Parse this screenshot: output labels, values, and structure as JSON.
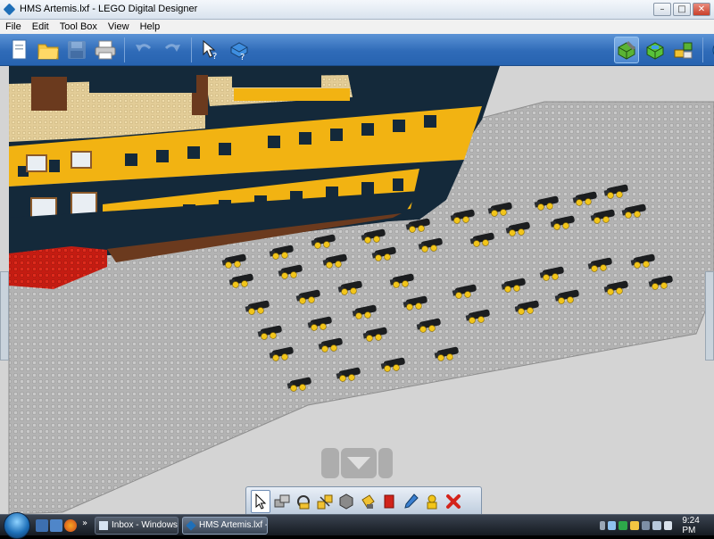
{
  "window": {
    "title": "HMS Artemis.lxf - LEGO Digital Designer",
    "minimize_glyph": "–",
    "maximize_glyph": "□",
    "close_glyph": "✕"
  },
  "menu": [
    "File",
    "Edit",
    "Tool Box",
    "View",
    "Help"
  ],
  "toolbar": {
    "left_icons": [
      "new-file-icon",
      "open-folder-icon",
      "save-disk-icon",
      "print-icon"
    ],
    "history_icons": [
      "undo-icon",
      "redo-icon"
    ],
    "help_icons": [
      "help-pointer-icon",
      "help-brick-icon"
    ],
    "mode_icons": [
      "build-mode-icon",
      "view-mode-icon",
      "building-guide-mode-icon",
      "share-icon"
    ]
  },
  "palette_icons": [
    "select-arrow-icon",
    "clone-icon",
    "hinge-icon",
    "hinge-align-icon",
    "flex-icon",
    "paint-bucket-icon",
    "decoration-icon",
    "color-picker-icon",
    "hide-icon",
    "delete-icon"
  ],
  "taskbar": {
    "tasks": [
      {
        "label": "Inbox - Windows Mail",
        "active": false
      },
      {
        "label": "HMS Artemis.lxf - L...",
        "active": true
      }
    ],
    "overflow": "»",
    "clock": "9:24 PM"
  },
  "colors": {
    "hull_dark": "#14293a",
    "hull_yellow": "#f2b312",
    "deck_tan": "#e3cd96",
    "red_brick": "#c81912",
    "brown_plate": "#6b3a1e",
    "baseplate": "#b5b5b5",
    "cannon": "#1b1d1f",
    "wheel": "#f2c51a"
  }
}
